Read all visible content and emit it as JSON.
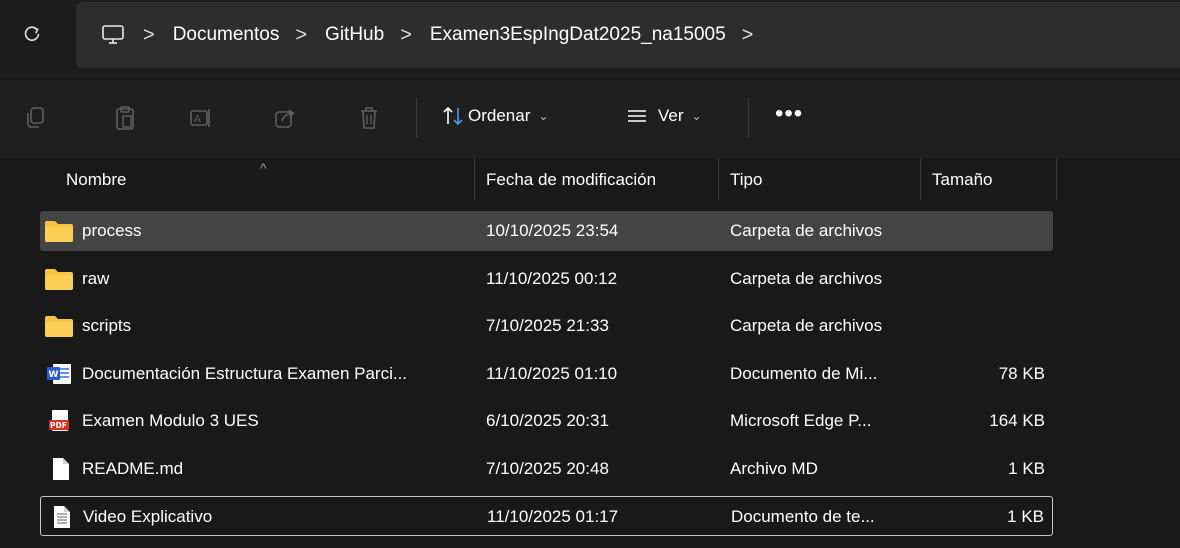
{
  "address_bar": {
    "breadcrumbs": [
      "Documentos",
      "GitHub",
      "Examen3EspIngDat2025_na15005"
    ],
    "separator": ">"
  },
  "toolbar": {
    "sort_label": "Ordenar",
    "view_label": "Ver",
    "more_label": "•••"
  },
  "columns": {
    "name": "Nombre",
    "date": "Fecha de modificación",
    "type": "Tipo",
    "size": "Tamaño"
  },
  "files": [
    {
      "name": "process",
      "date": "10/10/2025 23:54",
      "type": "Carpeta de archivos",
      "size": "",
      "icon": "folder-icon"
    },
    {
      "name": "raw",
      "date": "11/10/2025 00:12",
      "type": "Carpeta de archivos",
      "size": "",
      "icon": "folder-icon"
    },
    {
      "name": "scripts",
      "date": "7/10/2025 21:33",
      "type": "Carpeta de archivos",
      "size": "",
      "icon": "folder-icon"
    },
    {
      "name": "Documentación Estructura Examen Parci...",
      "date": "11/10/2025 01:10",
      "type": "Documento de Mi...",
      "size": "78 KB",
      "icon": "word-document-icon"
    },
    {
      "name": "Examen Modulo 3 UES",
      "date": "6/10/2025 20:31",
      "type": "Microsoft Edge P...",
      "size": "164 KB",
      "icon": "pdf-icon"
    },
    {
      "name": "README.md",
      "date": "7/10/2025 20:48",
      "type": "Archivo MD",
      "size": "1 KB",
      "icon": "blank-file-icon"
    },
    {
      "name": "Video Explicativo",
      "date": "11/10/2025 01:17",
      "type": "Documento de te...",
      "size": "1 KB",
      "icon": "text-file-icon"
    }
  ],
  "colors": {
    "background": "#191919",
    "folder": "#f5c443",
    "selected_row": "#444444",
    "word_blue": "#2b5cd6",
    "pdf_red": "#d93025"
  }
}
